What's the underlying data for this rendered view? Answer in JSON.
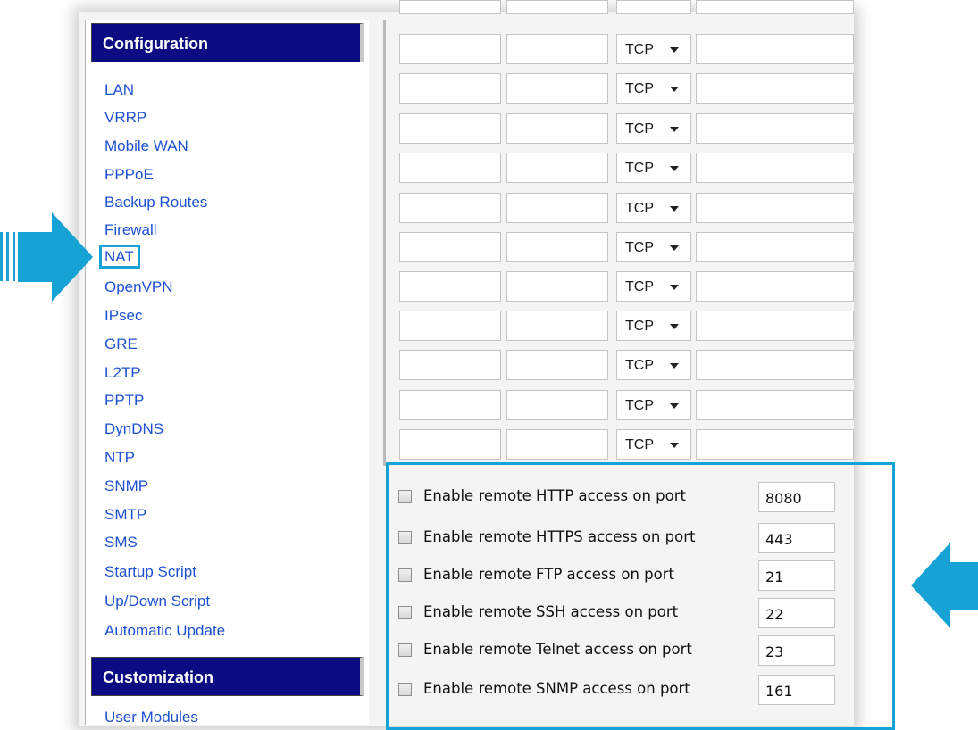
{
  "sidebar": {
    "configuration_header": "Configuration",
    "customization_header": "Customization",
    "items": [
      {
        "label": "LAN"
      },
      {
        "label": "VRRP"
      },
      {
        "label": "Mobile WAN"
      },
      {
        "label": "PPPoE"
      },
      {
        "label": "Backup Routes"
      },
      {
        "label": "Firewall"
      },
      {
        "label": "NAT",
        "selected": true
      },
      {
        "label": "OpenVPN"
      },
      {
        "label": "IPsec"
      },
      {
        "label": "GRE"
      },
      {
        "label": "L2TP"
      },
      {
        "label": "PPTP"
      },
      {
        "label": "DynDNS"
      },
      {
        "label": "NTP"
      },
      {
        "label": "SNMP"
      },
      {
        "label": "SMTP"
      },
      {
        "label": "SMS"
      },
      {
        "label": "Startup Script"
      },
      {
        "label": "Up/Down Script"
      },
      {
        "label": "Automatic Update"
      }
    ],
    "customization_items": [
      {
        "label": "User Modules"
      }
    ]
  },
  "nat_rules": {
    "protocol_value": "TCP"
  },
  "remote_access": [
    {
      "label": "Enable remote HTTP access on port",
      "port": "8080",
      "checked": false
    },
    {
      "label": "Enable remote HTTPS access on port",
      "port": "443",
      "checked": false
    },
    {
      "label": "Enable remote FTP access on port",
      "port": "21",
      "checked": false
    },
    {
      "label": "Enable remote SSH access on port",
      "port": "22",
      "checked": false
    },
    {
      "label": "Enable remote Telnet access on port",
      "port": "23",
      "checked": false
    },
    {
      "label": "Enable remote SNMP access on port",
      "port": "161",
      "checked": false
    }
  ],
  "colors": {
    "header_bg": "#0b0b82",
    "link": "#1d50d2",
    "highlight": "#17a2d6"
  }
}
